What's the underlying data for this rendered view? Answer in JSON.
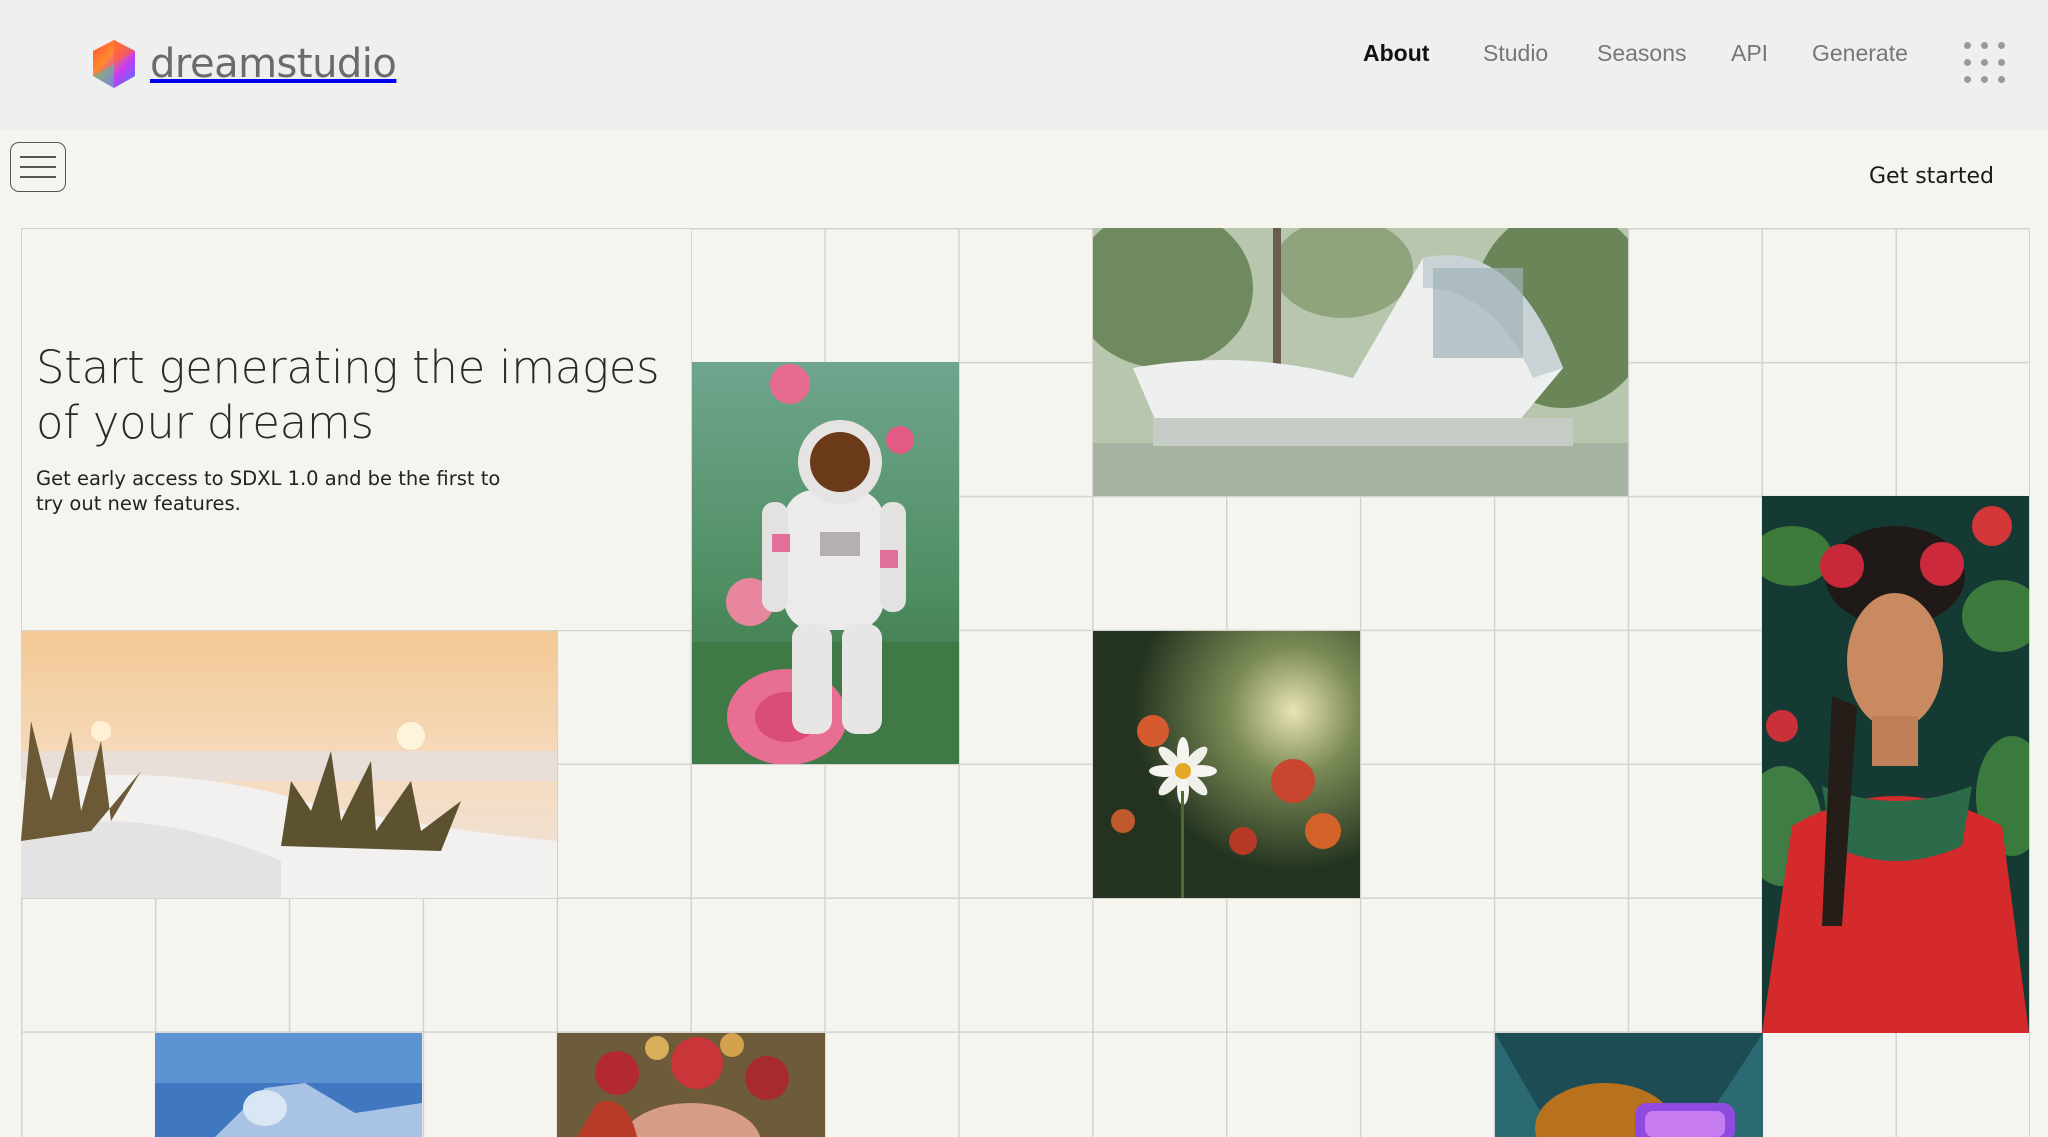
{
  "header": {
    "brand": "dreamstudio",
    "nav": [
      {
        "label": "About",
        "active": true
      },
      {
        "label": "Studio",
        "active": false
      },
      {
        "label": "Seasons",
        "active": false
      },
      {
        "label": "API",
        "active": false
      },
      {
        "label": "Generate",
        "active": false
      }
    ],
    "apps_icon": "grid-dots-icon"
  },
  "subbar": {
    "menu_icon": "hamburger-menu-icon",
    "cta_label": "Get started"
  },
  "hero": {
    "title": "Start generating the images of your dreams",
    "subtitle": "Get early access to SDXL 1.0 and be the first to try out new features."
  },
  "gallery": [
    {
      "name": "astronaut-roses-image"
    },
    {
      "name": "modern-house-image"
    },
    {
      "name": "dune-sunset-image"
    },
    {
      "name": "daisy-flowers-image"
    },
    {
      "name": "portrait-flowers-image"
    },
    {
      "name": "blue-jet-image"
    },
    {
      "name": "flower-crown-image"
    },
    {
      "name": "vr-dog-image"
    }
  ],
  "colors": {
    "background": "#f5f4ef",
    "header_bg": "#efefef",
    "grid_line": "#d2d2d0",
    "nav_active": "#111111",
    "nav_inactive": "#777777"
  }
}
